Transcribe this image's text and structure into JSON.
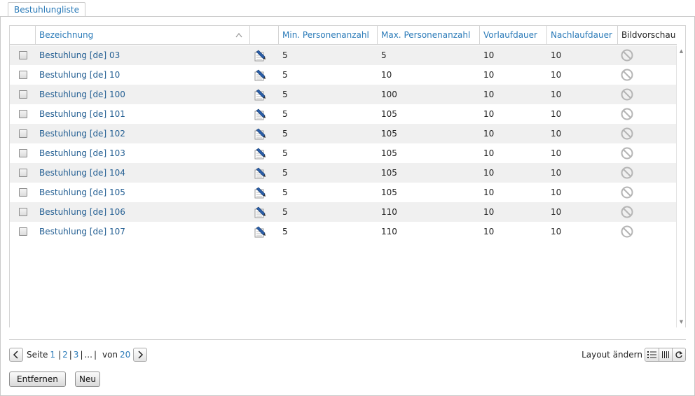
{
  "tab": {
    "label": "Bestuhlungliste"
  },
  "grid": {
    "columns": {
      "name": "Bezeichnung",
      "min": "Min. Personenanzahl",
      "max": "Max. Personenanzahl",
      "pre": "Vorlaufdauer",
      "post": "Nachlaufdauer",
      "preview": "Bildvorschau"
    },
    "sort_icon": "chevron-up-icon",
    "rows": [
      {
        "name": "Bestuhlung [de] 03",
        "min": "5",
        "max": "5",
        "pre": "10",
        "post": "10"
      },
      {
        "name": "Bestuhlung [de] 10",
        "min": "5",
        "max": "10",
        "pre": "10",
        "post": "10"
      },
      {
        "name": "Bestuhlung [de] 100",
        "min": "5",
        "max": "100",
        "pre": "10",
        "post": "10"
      },
      {
        "name": "Bestuhlung [de] 101",
        "min": "5",
        "max": "105",
        "pre": "10",
        "post": "10"
      },
      {
        "name": "Bestuhlung [de] 102",
        "min": "5",
        "max": "105",
        "pre": "10",
        "post": "10"
      },
      {
        "name": "Bestuhlung [de] 103",
        "min": "5",
        "max": "105",
        "pre": "10",
        "post": "10"
      },
      {
        "name": "Bestuhlung [de] 104",
        "min": "5",
        "max": "105",
        "pre": "10",
        "post": "10"
      },
      {
        "name": "Bestuhlung [de] 105",
        "min": "5",
        "max": "105",
        "pre": "10",
        "post": "10"
      },
      {
        "name": "Bestuhlung [de] 106",
        "min": "5",
        "max": "110",
        "pre": "10",
        "post": "10"
      },
      {
        "name": "Bestuhlung [de] 107",
        "min": "5",
        "max": "110",
        "pre": "10",
        "post": "10"
      }
    ]
  },
  "pager": {
    "prev_icon": "chevron-left-icon",
    "next_icon": "chevron-right-icon",
    "page_label": "Seite",
    "page1": "1",
    "page2": "2",
    "page3": "3",
    "ellipsis": "...",
    "of_label": "von",
    "total": "20"
  },
  "layout": {
    "label": "Layout ändern",
    "icons": [
      "list-icon",
      "columns-icon",
      "refresh-icon"
    ]
  },
  "buttons": {
    "remove": "Entfernen",
    "new": "Neu"
  },
  "colors": {
    "link": "#245f93",
    "header_link": "#2a7ab8",
    "row_alt": "#f0f0f0"
  }
}
